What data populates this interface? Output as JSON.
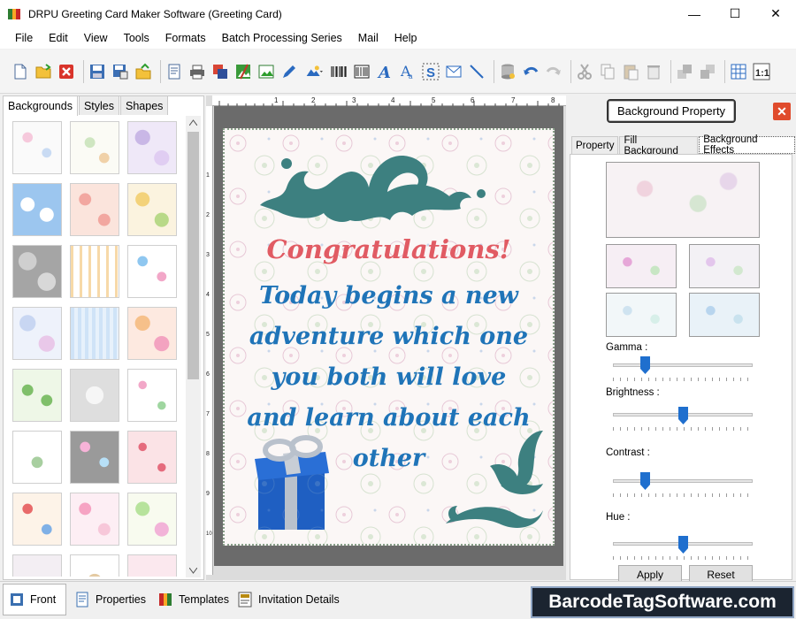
{
  "window": {
    "title": "DRPU Greeting Card Maker Software (Greeting Card)",
    "min_glyph": "—",
    "max_glyph": "☐",
    "close_glyph": "✕"
  },
  "menu": [
    "File",
    "Edit",
    "View",
    "Tools",
    "Formats",
    "Batch Processing Series",
    "Mail",
    "Help"
  ],
  "menu_overflow": "»",
  "left_panel": {
    "tabs": [
      "Backgrounds",
      "Styles",
      "Shapes"
    ],
    "active_tab": "Backgrounds"
  },
  "card": {
    "heading": "Congratulations!",
    "lines": [
      "Today begins a new",
      "adventure which one",
      "you both will love",
      "and learn about each",
      "other"
    ],
    "heading_color": "#e15b63",
    "body_color": "#1f74b8"
  },
  "ruler": {
    "top_ticks": [
      "1",
      "2",
      "3",
      "4",
      "5",
      "6",
      "7",
      "8"
    ],
    "left_ticks": [
      "1",
      "2",
      "3",
      "4",
      "5",
      "6",
      "7",
      "8",
      "9",
      "10"
    ]
  },
  "right_panel": {
    "title_button": "Background Property",
    "close_glyph": "✕",
    "tabs": [
      "Property",
      "Fill Background",
      "Background Effects"
    ],
    "active_tab": "Background Effects",
    "sliders": [
      {
        "label": "Gamma :",
        "value": 0.25
      },
      {
        "label": "Brightness :",
        "value": 0.5
      },
      {
        "label": "Contrast :",
        "value": 0.25
      },
      {
        "label": "Hue :",
        "value": 0.5
      }
    ],
    "apply_label": "Apply",
    "reset_label": "Reset"
  },
  "bottom_tabs": [
    {
      "label": "Front",
      "icon": "front-icon",
      "active": true
    },
    {
      "label": "Properties",
      "icon": "properties-icon",
      "active": false
    },
    {
      "label": "Templates",
      "icon": "templates-icon",
      "active": false
    },
    {
      "label": "Invitation Details",
      "icon": "invitation-details-icon",
      "active": false
    }
  ],
  "brand": "BarcodeTagSoftware.com",
  "colors": {
    "accent": "#1f6fce",
    "close_red": "#e04b2c",
    "brand_bg": "#1b2430"
  }
}
